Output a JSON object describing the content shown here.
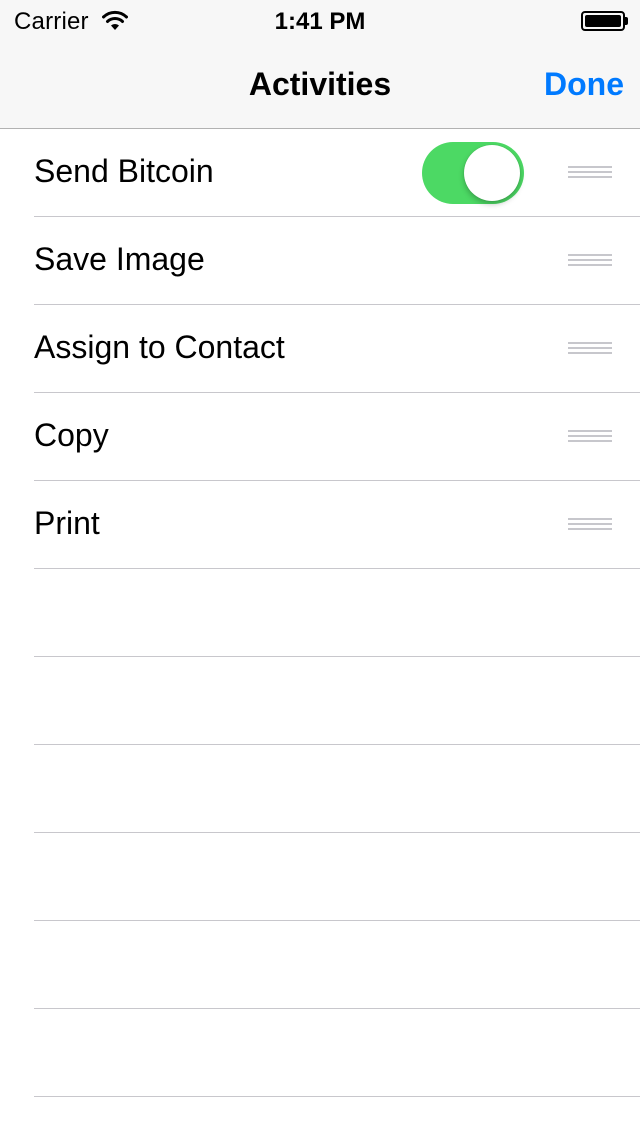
{
  "status_bar": {
    "carrier": "Carrier",
    "time": "1:41 PM",
    "wifi_icon": "wifi-icon",
    "battery_icon": "battery-icon"
  },
  "nav": {
    "title": "Activities",
    "done_label": "Done",
    "accent_color": "#007aff"
  },
  "activities": [
    {
      "label": "Send Bitcoin",
      "has_toggle": true,
      "toggle_on": true,
      "toggle_color": "#4cd964"
    },
    {
      "label": "Save Image",
      "has_toggle": false
    },
    {
      "label": "Assign to Contact",
      "has_toggle": false
    },
    {
      "label": "Copy",
      "has_toggle": false
    },
    {
      "label": "Print",
      "has_toggle": false
    }
  ],
  "empty_rows": 6
}
